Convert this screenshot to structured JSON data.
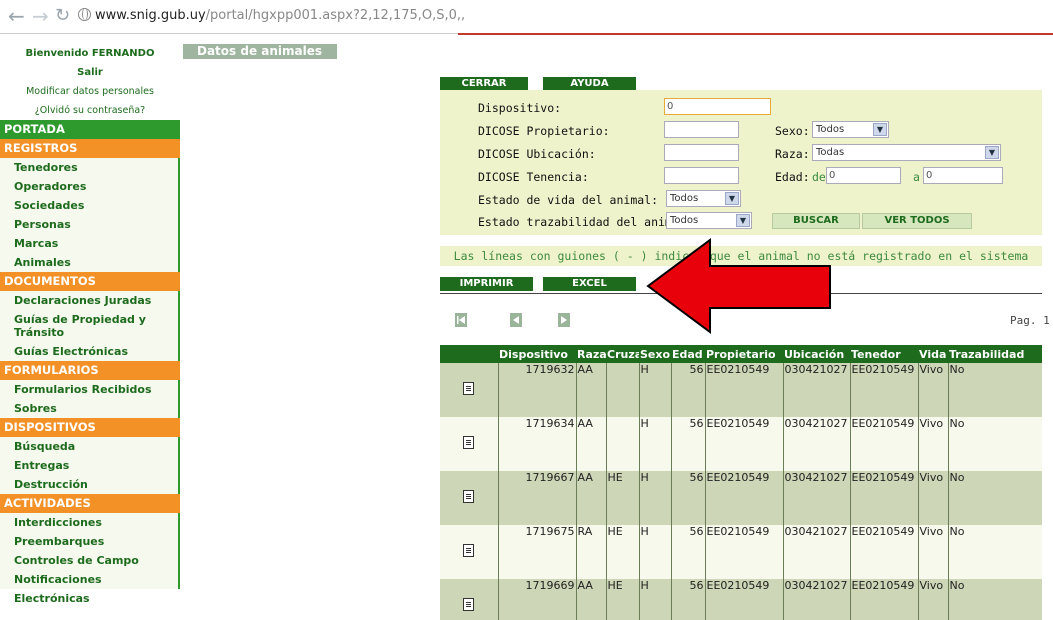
{
  "browser": {
    "url_host": "www.snig.gub.uy",
    "url_path": "/portal/hgxpp001.aspx?2,12,175,O,S,0,,",
    "back_icon": "back-arrow-icon",
    "forward_icon": "forward-arrow-icon",
    "reload_icon": "reload-icon"
  },
  "sidebar": {
    "welcome": "Bienvenido FERNANDO",
    "logout": "Salir",
    "edit_profile": "Modificar datos personales",
    "forgot_password": "¿Olvidó su contraseña?",
    "sections": [
      {
        "title": "PORTADA",
        "color": "green",
        "items": []
      },
      {
        "title": "REGISTROS",
        "color": "orange",
        "items": [
          "Tenedores",
          "Operadores",
          "Sociedades",
          "Personas",
          "Marcas",
          "Animales"
        ]
      },
      {
        "title": "DOCUMENTOS",
        "color": "orange",
        "items": [
          "Declaraciones Juradas",
          "Guías de Propiedad y Tránsito",
          "Guías Electrónicas"
        ]
      },
      {
        "title": "FORMULARIOS",
        "color": "orange",
        "items": [
          "Formularios Recibidos",
          "Sobres"
        ]
      },
      {
        "title": "DISPOSITIVOS",
        "color": "orange",
        "items": [
          "Búsqueda",
          "Entregas",
          "Destrucción"
        ]
      },
      {
        "title": "ACTIVIDADES",
        "color": "orange",
        "items": [
          "Interdicciones",
          "Preembarques",
          "Controles de Campo",
          "Notificaciones Electrónicas"
        ]
      }
    ]
  },
  "main": {
    "title": "Datos de animales",
    "btn_close": "CERRAR",
    "btn_help": "AYUDA",
    "form": {
      "dispositivo_label": "Dispositivo:",
      "dispositivo_value": "0",
      "propietario_label": "DICOSE Propietario:",
      "propietario_value": "",
      "ubicacion_label": "DICOSE Ubicación:",
      "ubicacion_value": "",
      "tenencia_label": "DICOSE Tenencia:",
      "tenencia_value": "",
      "vida_label": "Estado de vida del animal:",
      "vida_value": "Todos",
      "trazabilidad_label": "Estado trazabilidad del animal:",
      "trazabilidad_value": "Todos",
      "sexo_label": "Sexo:",
      "sexo_value": "Todos",
      "raza_label": "Raza:",
      "raza_value": "Todas",
      "edad_label": "Edad:",
      "edad_de_label": "de",
      "edad_de_value": "0",
      "edad_a_label": "a",
      "edad_a_value": "0",
      "btn_search": "BUSCAR",
      "btn_all": "VER TODOS"
    },
    "info_text": "Las líneas con guiones ( - ) indican que el animal no está registrado en el sistema",
    "btn_print": "IMPRIMIR",
    "btn_excel": "EXCEL",
    "pager": "Pag. 1",
    "table": {
      "headers": [
        "",
        "Dispositivo",
        "Raza",
        "Cruza",
        "Sexo",
        "Edad",
        "Propietario",
        "Ubicación",
        "Tenedor",
        "Vida",
        "Trazabilidad"
      ],
      "rows": [
        [
          "1719632",
          "AA",
          "",
          "H",
          "56",
          "EE0210549",
          "030421027",
          "EE0210549",
          "Vivo",
          "No"
        ],
        [
          "1719634",
          "AA",
          "",
          "H",
          "56",
          "EE0210549",
          "030421027",
          "EE0210549",
          "Vivo",
          "No"
        ],
        [
          "1719667",
          "AA",
          "HE",
          "H",
          "56",
          "EE0210549",
          "030421027",
          "EE0210549",
          "Vivo",
          "No"
        ],
        [
          "1719675",
          "RA",
          "HE",
          "H",
          "56",
          "EE0210549",
          "030421027",
          "EE0210549",
          "Vivo",
          "No"
        ],
        [
          "1719669",
          "AA",
          "HE",
          "H",
          "56",
          "EE0210549",
          "030421027",
          "EE0210549",
          "Vivo",
          "No"
        ]
      ]
    }
  },
  "colors": {
    "green_dark": "#1e6b1e",
    "green_section": "#2e9a2e",
    "orange_section": "#f39127",
    "form_bg": "#eef3cc",
    "arrow": "#e8000b"
  }
}
